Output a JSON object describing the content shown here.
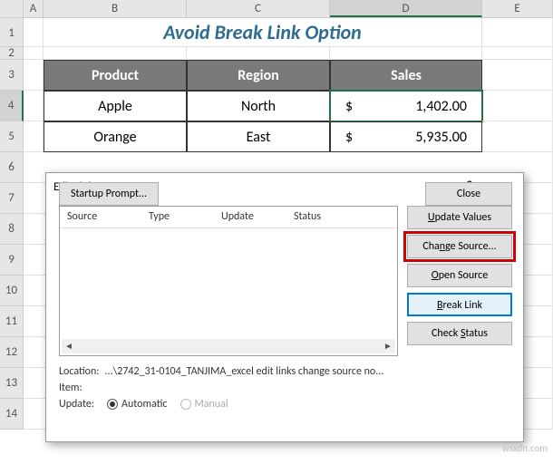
{
  "columns": {
    "A": "A",
    "B": "B",
    "C": "C",
    "D": "D",
    "E": "E"
  },
  "row_nums": [
    "1",
    "2",
    "3",
    "4",
    "5",
    "6",
    "7",
    "8",
    "9",
    "10",
    "11",
    "12",
    "13",
    "14"
  ],
  "title": "Avoid Break Link Option",
  "table": {
    "headers": {
      "product": "Product",
      "region": "Region",
      "sales": "Sales"
    },
    "rows": [
      {
        "product": "Apple",
        "region": "North",
        "currency": "$",
        "sales": "1,402.00"
      },
      {
        "product": "Orange",
        "region": "East",
        "currency": "$",
        "sales": "5,935.00"
      }
    ]
  },
  "dialog": {
    "title": "Edit Links",
    "list_headers": {
      "source": "Source",
      "type": "Type",
      "update": "Update",
      "status": "Status"
    },
    "buttons": {
      "update_values": "Update Values",
      "change_source": "Change Source...",
      "open_source": "Open Source",
      "break_link": "Break Link",
      "check_status": "Check Status"
    },
    "info": {
      "location_label": "Location:",
      "location_value": "...\\2742_31-0104_TANJIMA_excel edit links change source no...",
      "item_label": "Item:",
      "update_label": "Update:",
      "automatic": "Automatic",
      "manual": "Manual"
    },
    "startup": "Startup Prompt...",
    "close": "Close",
    "help": "?",
    "x": "×"
  },
  "watermark": "wsxdn.com"
}
